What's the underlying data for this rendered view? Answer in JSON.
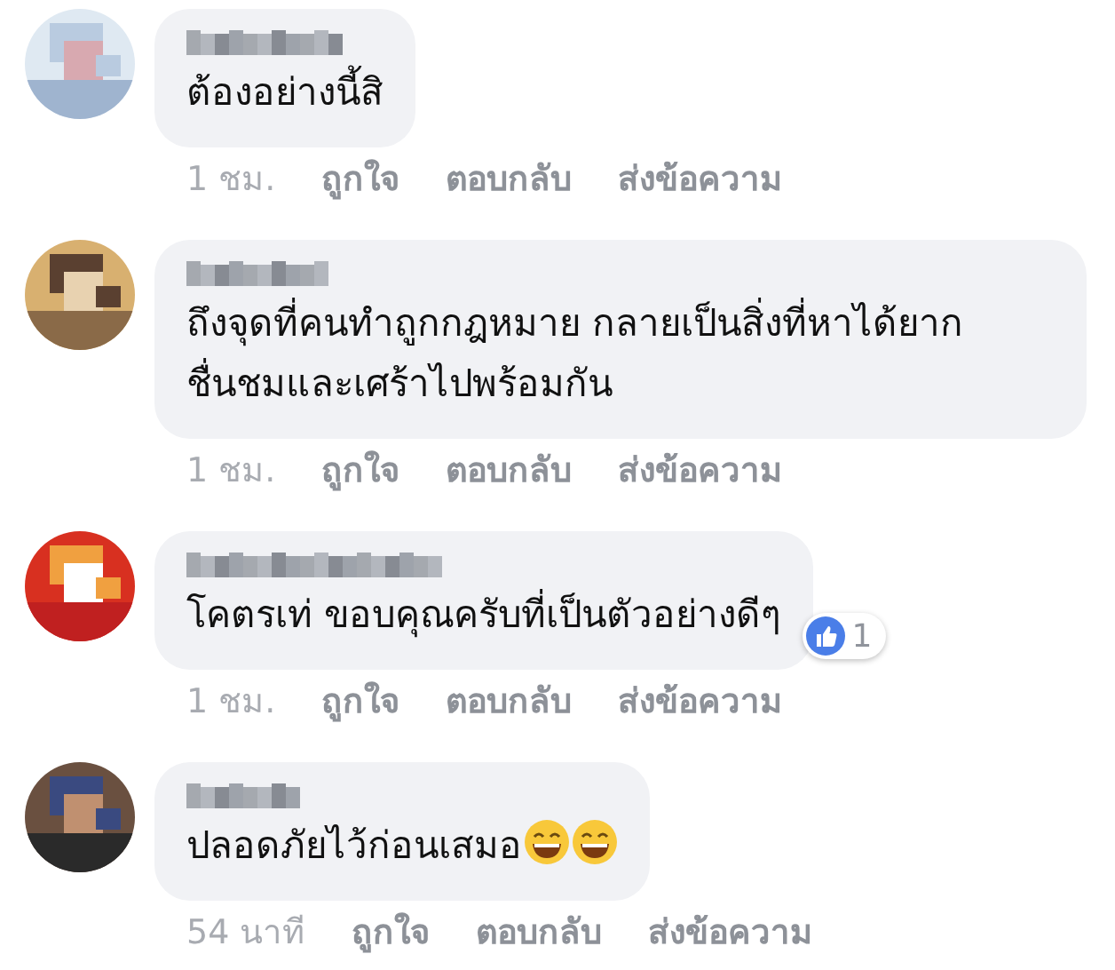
{
  "comments": [
    {
      "avatar": {
        "kind": "picture"
      },
      "text": "ต้องอย่างนี้สิ",
      "time": "1 ชม.",
      "actions": [
        "ถูกใจ",
        "ตอบกลับ",
        "ส่งข้อความ"
      ]
    },
    {
      "avatar": {
        "kind": "picture"
      },
      "text": "ถึงจุดที่คนทำถูกกฎหมาย กลายเป็นสิ่งที่หาได้ยาก ชื่นชมและเศร้าไปพร้อมกัน",
      "time": "1 ชม.",
      "actions": [
        "ถูกใจ",
        "ตอบกลับ",
        "ส่งข้อความ"
      ]
    },
    {
      "avatar": {
        "kind": "picture"
      },
      "text": "โคตรเท่ ขอบคุณครับที่เป็นตัวอย่างดีๆ",
      "time": "1 ชม.",
      "actions": [
        "ถูกใจ",
        "ตอบกลับ",
        "ส่งข้อความ"
      ],
      "likes": "1"
    },
    {
      "avatar": {
        "kind": "picture"
      },
      "text": "ปลอดภัยไว้ก่อนเสมอ",
      "emojis": [
        {
          "kind": "grin"
        },
        {
          "kind": "grin"
        }
      ],
      "time": "54 นาที",
      "actions": [
        "ถูกใจ",
        "ตอบกลับ",
        "ส่งข้อความ"
      ]
    }
  ]
}
